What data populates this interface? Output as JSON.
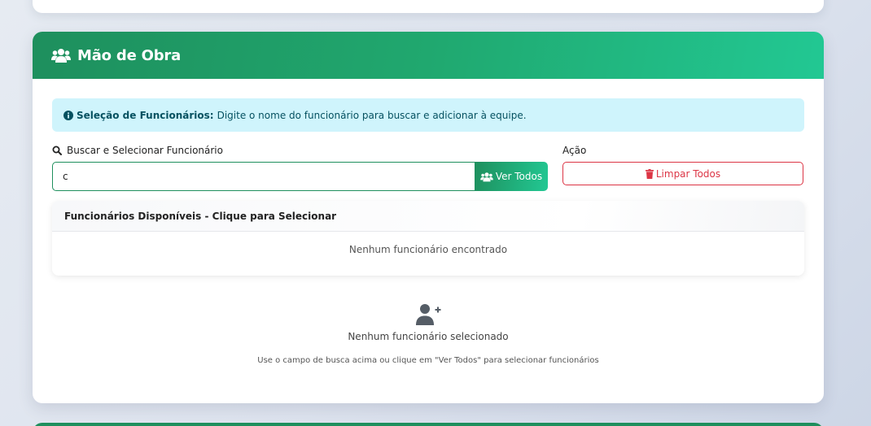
{
  "section": {
    "title": "Mão de Obra",
    "icon": "users-icon",
    "header_gradient": [
      "#1e8f5d",
      "#22c893"
    ]
  },
  "alert": {
    "icon": "info-circle-icon",
    "strong": "Seleção de Funcionários:",
    "text": "Digite o nome do funcionário para buscar e adicionar à equipe."
  },
  "search": {
    "label": "Buscar e Selecionar Funcionário",
    "icon": "search-icon",
    "value": "c",
    "view_all_label": "Ver Todos"
  },
  "action": {
    "label": "Ação",
    "clear_label": "Limpar Todos",
    "clear_icon": "trash-icon",
    "danger_color": "#dc3545"
  },
  "available_list": {
    "title": "Funcionários Disponíveis - Clique para Selecionar",
    "empty_text": "Nenhum funcionário encontrado"
  },
  "selected": {
    "icon": "user-plus-icon",
    "empty_title": "Nenhum funcionário selecionado",
    "empty_hint": "Use o campo de busca acima ou clique em \"Ver Todos\" para selecionar funcionários"
  }
}
